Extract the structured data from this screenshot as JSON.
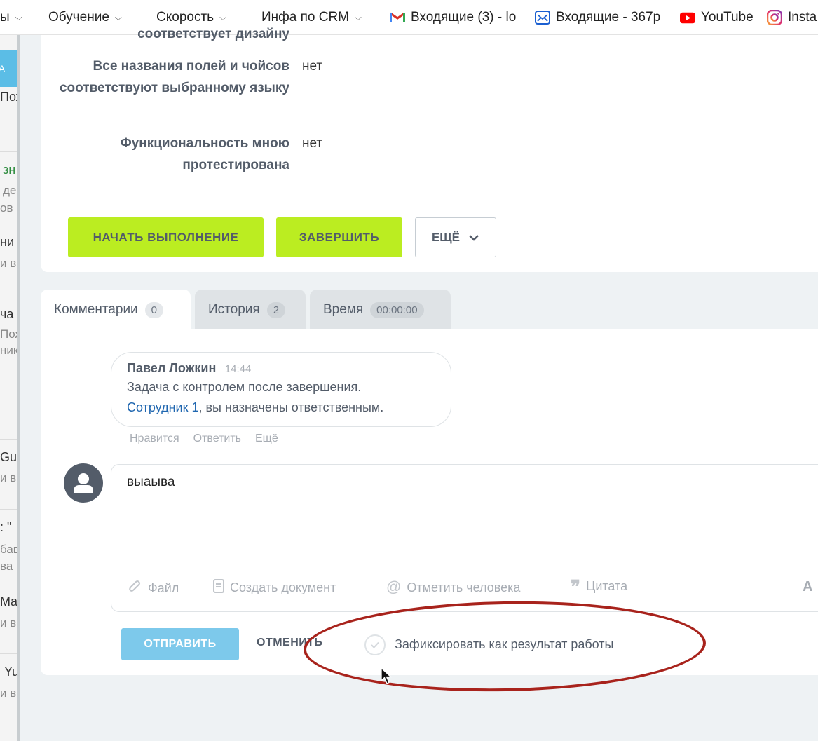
{
  "bookmarks": {
    "items": [
      {
        "label": "ы"
      },
      {
        "label": "Обучение"
      },
      {
        "label": "Скорость"
      },
      {
        "label": "Инфа по CRM"
      },
      {
        "label": "Входящие (3) - lo"
      },
      {
        "label": "Входящие - 367р"
      },
      {
        "label": "YouTube"
      },
      {
        "label": "Insta"
      }
    ]
  },
  "sidebar_fragments": [
    "А",
    "Пож",
    "зн",
    "де",
    "ов",
    "ни",
    "и в",
    "ча",
    "Пож",
    "ник",
    "Gu",
    "и в",
    ": \"",
    "бав",
    "ва",
    "Ma",
    "и в",
    "Yu",
    "и в"
  ],
  "task_fields": {
    "top_fragment": "соответствует дизайну",
    "rows": [
      {
        "label": "Все названия полей и чойсов соответствуют выбранному языку",
        "value": "нет"
      },
      {
        "label": "Функциональность мною протестирована",
        "value": "нет"
      }
    ]
  },
  "task_actions": {
    "start_label": "НАЧАТЬ ВЫПОЛНЕНИЕ",
    "finish_label": "ЗАВЕРШИТЬ",
    "more_label": "ЕЩЁ"
  },
  "tabs": [
    {
      "label": "Комментарии",
      "counter": "0"
    },
    {
      "label": "История",
      "counter": "2"
    },
    {
      "label": "Время",
      "counter": "00:00:00"
    }
  ],
  "comment": {
    "author": "Павел Ложкин",
    "time": "14:44",
    "line1": "Задача с контролем после завершения.",
    "mention": "Сотрудник 1",
    "line2_rest": ", вы назначены ответственным.",
    "actions": [
      "Нравится",
      "Ответить",
      "Ещё"
    ]
  },
  "editor": {
    "text": "выаыва",
    "tools": {
      "file": "Файл",
      "document": "Создать документ",
      "mention": "Отметить человека",
      "quote": "Цитата",
      "format": "A"
    }
  },
  "form": {
    "send_label": "ОТПРАВИТЬ",
    "cancel_label": "ОТМЕНИТЬ",
    "result_label": "Зафиксировать как результат работы"
  },
  "colors": {
    "accent_green": "#bbed21",
    "send_blue": "#7dc9eb",
    "annotation_red": "#a8231c"
  }
}
